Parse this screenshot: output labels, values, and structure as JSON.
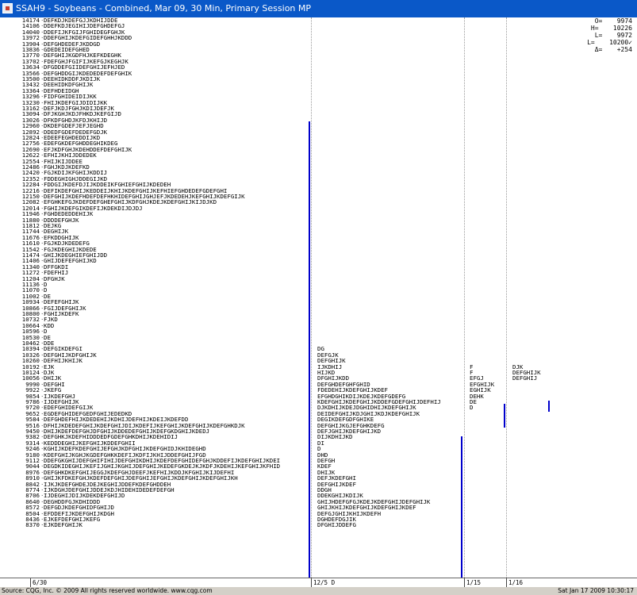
{
  "window": {
    "title": "SSAH9 - Soybeans - Combined, Mar 09, 30 Min, Primary Session MP"
  },
  "summary": [
    {
      "label": "O=",
      "value": "9974"
    },
    {
      "label": "H=",
      "value": "10226"
    },
    {
      "label": "L=",
      "value": "9972"
    },
    {
      "label": "L=",
      "value": "10200✓"
    },
    {
      "label": "Δ=",
      "value": "+254"
    }
  ],
  "status": {
    "source": "Source: CQG, Inc. © 2009 All rights reserved worldwide.  www.cqg.com",
    "datetime": "Sat Jan 17 2009 10:30:17"
  },
  "x_axis": [
    "6/30",
    "12/5  D",
    "1/15",
    "1/16"
  ],
  "profile_rows": [
    {
      "price": "14174",
      "letters": "DEFKDJKDEFGJJKDHIJDDE"
    },
    {
      "price": "14106",
      "letters": "DDEFKDJEGIHIJDEFGHDEFGJ"
    },
    {
      "price": "14040",
      "letters": "DDEFIJKFGIJFGHIDEGFGHJK"
    },
    {
      "price": "13972",
      "letters": "DDEFGHIJKDEFGIDEFGHHJKDDD"
    },
    {
      "price": "13904",
      "letters": "DEFGHDEDEFJKDDGD"
    },
    {
      "price": "13836",
      "letters": "GDEDEIDEFGHED"
    },
    {
      "price": "13770",
      "letters": "DEFGHIJKGDFHJKEFKDEGHK"
    },
    {
      "price": "13702",
      "letters": "FDEFGHJFGIFIJKEFGJKEGHJK"
    },
    {
      "price": "13634",
      "letters": "DFGDDEFGIIDEFGHIJEFHJED"
    },
    {
      "price": "13566",
      "letters": "DEFGHDDGIJKDEDEDEFDEFGHIK"
    },
    {
      "price": "13500",
      "letters": "DEEHIDKDDFJKDIJK"
    },
    {
      "price": "13432",
      "letters": "DEEHIDKDFGHIJK"
    },
    {
      "price": "13364",
      "letters": "DEFHDEIDGH"
    },
    {
      "price": "13296",
      "letters": "FIDFGHIDEIDIJKK"
    },
    {
      "price": "13230",
      "letters": "FHIJKDEFGIJDIDIJKK"
    },
    {
      "price": "13162",
      "letters": "DEFJKDJFGHJKDIJDEFJK"
    },
    {
      "price": "13094",
      "letters": "DFJKGHJKDJFHKDJKEFGIJD"
    },
    {
      "price": "13026",
      "letters": "DFKDFGHDJKFDJKHIJD"
    },
    {
      "price": "12960",
      "letters": "DKDEFGDEFJEFJEGHD"
    },
    {
      "price": "12892",
      "letters": "DDEDFGDEFDEDEFGDJK"
    },
    {
      "price": "12824",
      "letters": "EDEEFEGHDEDDIJKD"
    },
    {
      "price": "12756",
      "letters": "EDEFGKDEFGHDDEGHIKDEG"
    },
    {
      "price": "12690",
      "letters": "EFJKDFGHJKDEHDDEFDEFGHIJK"
    },
    {
      "price": "12622",
      "letters": "EFHIJKHIJDDEDEK"
    },
    {
      "price": "12554",
      "letters": "FHIJKIJDDEE"
    },
    {
      "price": "12486",
      "letters": "FGHJKDJKDEFKD"
    },
    {
      "price": "12420",
      "letters": "FGJKDIJKFGHIJKDDIJ"
    },
    {
      "price": "12352",
      "letters": "FDDEGHIGHJDDEGIJKD"
    },
    {
      "price": "12284",
      "letters": "FDDGIJKDEFDJIJKDDEIKFGHIEFGHIJKDEDEH"
    },
    {
      "price": "12216",
      "letters": "DEFIKDEFGHIJKEDDEIJKHIJKDEFGHIJKEFHIEFGHDEDEFGDEFGHI"
    },
    {
      "price": "12150",
      "letters": "DEFGHIJKDEFHDEFDEFHKHIDEFGHIJGHJEFJKDEDEHJKEFGHIJKDEFGIJK"
    },
    {
      "price": "12082",
      "letters": "EFGHKEFGJKDEFDEFGHEFGHIJKDFGHJKDEJKDEFGHIJKIJDJKD"
    },
    {
      "price": "12014",
      "letters": "FGHIJKDEFGIKDEFIJKDEKDIJDJDJ"
    },
    {
      "price": "11946",
      "letters": "FGHDEDEDDEHIJK"
    },
    {
      "price": "11880",
      "letters": "DDDDEFGHJK"
    },
    {
      "price": "11812",
      "letters": "DEJKG"
    },
    {
      "price": "11744",
      "letters": "DEGHIJK"
    },
    {
      "price": "11676",
      "letters": "EFKDDGHIJK"
    },
    {
      "price": "11610",
      "letters": "FGJKDJKDEDEFG"
    },
    {
      "price": "11542",
      "letters": "FGJKDEGHIJKDEDE"
    },
    {
      "price": "11474",
      "letters": "GHIJKDEGHIEFGHIJDD"
    },
    {
      "price": "11406",
      "letters": "GHIJDEFEFGHIJKD"
    },
    {
      "price": "11340",
      "letters": "DFFGKDI"
    },
    {
      "price": "11272",
      "letters": "FDEFHIJ"
    },
    {
      "price": "11204",
      "letters": "DFGHJK"
    },
    {
      "price": "11136",
      "letters": "D"
    },
    {
      "price": "11070",
      "letters": "D"
    },
    {
      "price": "11002",
      "letters": "DE"
    },
    {
      "price": "10934",
      "letters": "DEFEFGHIJK"
    },
    {
      "price": "10866",
      "letters": "FGIJDEFGHIJK"
    },
    {
      "price": "10800",
      "letters": "FGHIJKDEFK"
    },
    {
      "price": "10732",
      "letters": "FJKD"
    },
    {
      "price": "10664",
      "letters": "KDD"
    },
    {
      "price": "10596",
      "letters": "D"
    },
    {
      "price": "10530",
      "letters": "DE"
    },
    {
      "price": "10462",
      "letters": "DDE"
    },
    {
      "price": "10394",
      "letters": "DEFGIKDEFGI"
    },
    {
      "price": "10326",
      "letters": "DEFGHIJKDFGHIJK"
    },
    {
      "price": "10260",
      "letters": "DEFHIJKHIJK"
    },
    {
      "price": "10192",
      "letters": "EJK"
    },
    {
      "price": "10124",
      "letters": "DJK"
    },
    {
      "price": "10056",
      "letters": "DHIJK"
    },
    {
      "price": "9990",
      "letters": "DEFGHI"
    },
    {
      "price": "9922",
      "letters": "JKEFG"
    },
    {
      "price": "9854",
      "letters": "IJKDEFGHJ"
    },
    {
      "price": "9786",
      "letters": "IJDEFGHIJK"
    },
    {
      "price": "9720",
      "letters": "EDEFGHIDEFGIJK"
    },
    {
      "price": "9652",
      "letters": "EGDEFGHIDEFGEDFGHIJEDEDKD"
    },
    {
      "price": "9584",
      "letters": "DEFGHDEFHIJKDEDEHIJKDHIJDEFHIJKDEIJKDEFDD"
    },
    {
      "price": "9516",
      "letters": "DFHIJKDEDEFGHIJKDEFGHIJDIJKDEFIJKEFGHIJKDEFGHIJKDEFGHKDJK"
    },
    {
      "price": "9450",
      "letters": "DHIJKDEFDEFGHJDFGHIJKDDEDEFGHIJKDEFGKDGHIJKDEDJ"
    },
    {
      "price": "9382",
      "letters": "DEFGHKJKDEFHIDDDEDFGDEFGHKDHIJKDEHIDIJ"
    },
    {
      "price": "9314",
      "letters": "KEDDDEGHIJKEFGHIJKDDEFGHII"
    },
    {
      "price": "9246",
      "letters": "KGHIJKDEFKDEFGHIJEFGHJKDFGHIJKDEFGHIDJKHIDEGHD"
    },
    {
      "price": "9180",
      "letters": "KDEFGHIJKGHJKGDEFGHKKDEFIJKDFIJKHIJDDEFGHIJFGD"
    },
    {
      "price": "9112",
      "letters": "DDEFGKGHIJDEFGHIFIHIJDEFGHIKDHIJKDEFDEFGHIDEFGHJKDDEFIJKDEFGHIJKDEI"
    },
    {
      "price": "9044",
      "letters": "DEGDKIDEGHIJKEFIJGHIJKGHIJDEFGHIJKEDEFGKDEJKJKDFJKDEHIJKEFGHIJKFHID"
    },
    {
      "price": "8976",
      "letters": "DEFGHKDKEFGHIJEGGJKDEFGHJDEEFJKEFHIJKDDJKFGHIJKIJDEFHI"
    },
    {
      "price": "8910",
      "letters": "GHIJKFDKEFGHJKDEFDEFGHIJDEFGHIJEFGHIJKDEFGHIJKDEFGHIJKH"
    },
    {
      "price": "8842",
      "letters": "IJKJKDEFGHDEJDEJKEGHIJDDEFKDEFGHDDEH"
    },
    {
      "price": "8774",
      "letters": "IJKDGHJDEFGHIJDDEJKDJHIDEHIDEDEFDEFGH"
    },
    {
      "price": "8706",
      "letters": "IJDEGHIJDIJKDEKDEFGHIJD"
    },
    {
      "price": "8640",
      "letters": "DEGHDDFGJKDHIDDD"
    },
    {
      "price": "8572",
      "letters": "DEFGDJKDEFGHIDFGHIJD"
    },
    {
      "price": "8504",
      "letters": "EFDDEFIJKDEFGHIJKDGH"
    },
    {
      "price": "8436",
      "letters": "EJKEFDEFGHIJKEFG"
    },
    {
      "price": "8370",
      "letters": "EJKDEFGHIJK"
    }
  ],
  "col2_rows": [
    {
      "price": "10394",
      "letters": "DG"
    },
    {
      "price": "10326",
      "letters": "DEFGJK"
    },
    {
      "price": "10260",
      "letters": "DEFGHIJK"
    },
    {
      "price": "10192",
      "letters": "IJKDHIJ"
    },
    {
      "price": "10124",
      "letters": "HIJKD"
    },
    {
      "price": "10056",
      "letters": "DFGHIJKDD"
    },
    {
      "price": "9990",
      "letters": "DEFGHDEFGHFGHID"
    },
    {
      "price": "9922",
      "letters": "FDEDEHIJKDEFGHIJKDEF"
    },
    {
      "price": "9854",
      "letters": "EFGHDGHIKDIJKDEJKDEFGDEFG"
    },
    {
      "price": "9786",
      "letters": "KDEFGHIJKDEFGHIJKDDEFGDEFGHIJDEFHIJ"
    },
    {
      "price": "9720",
      "letters": "DJKDHIJKDEJDGHIDHIJKDEFGHIJK"
    },
    {
      "price": "9652",
      "letters": "DEIDEFGHIJKDJGHIJKDJKDEFGHIJK"
    },
    {
      "price": "9584",
      "letters": "DEGIKDEFGDFGHIKE"
    },
    {
      "price": "9516",
      "letters": "DEFGHIJKGJEFGHKDEFG"
    },
    {
      "price": "9450",
      "letters": "DEFJGHIJKDEFGHIJKD"
    },
    {
      "price": "9382",
      "letters": "DIJKDHIJKD"
    },
    {
      "price": "9314",
      "letters": "DI"
    },
    {
      "price": "9246",
      "letters": "D"
    },
    {
      "price": "9180",
      "letters": "DHD"
    },
    {
      "price": "9112",
      "letters": "DEFGH"
    },
    {
      "price": "9044",
      "letters": "KDEF"
    },
    {
      "price": "8976",
      "letters": "DHIJK"
    },
    {
      "price": "8910",
      "letters": "DEFJKDEFGHI"
    },
    {
      "price": "8842",
      "letters": "DEFGHIJKDEF"
    },
    {
      "price": "8774",
      "letters": "DDGH"
    },
    {
      "price": "8706",
      "letters": "DDEKGHIJKDIJK"
    },
    {
      "price": "8640",
      "letters": "GHIJHDEFGFGJKDEJKDEFGHIJDEFGHIJK"
    },
    {
      "price": "8572",
      "letters": "GHIJKHIJKDEFGHIJKDEFGHIJKDEF"
    },
    {
      "price": "8504",
      "letters": "DEFGJGHIJKHIJKDEFH"
    },
    {
      "price": "8436",
      "letters": "DGHDEFDGJIK"
    },
    {
      "price": "8370",
      "letters": "DFGHIJDDEFG"
    }
  ],
  "col3_rows": [
    {
      "price": "10192",
      "letters": "F"
    },
    {
      "price": "10124",
      "letters": "F"
    },
    {
      "price": "10056",
      "letters": "EFGJ"
    },
    {
      "price": "9990",
      "letters": "EFGHIJK"
    },
    {
      "price": "9922",
      "letters": "EGHIJK"
    },
    {
      "price": "9854",
      "letters": "DEHK"
    },
    {
      "price": "9786",
      "letters": "DE"
    },
    {
      "price": "9720",
      "letters": "D"
    }
  ],
  "col4_rows": [
    {
      "price": "10192",
      "letters": "DJK"
    },
    {
      "price": "10124",
      "letters": "DEFGHIJK"
    },
    {
      "price": "10056",
      "letters": "DEFGHIJ"
    }
  ],
  "colors": {
    "title_bar": "#0a58c8",
    "value_area_line": "#0000cc"
  }
}
